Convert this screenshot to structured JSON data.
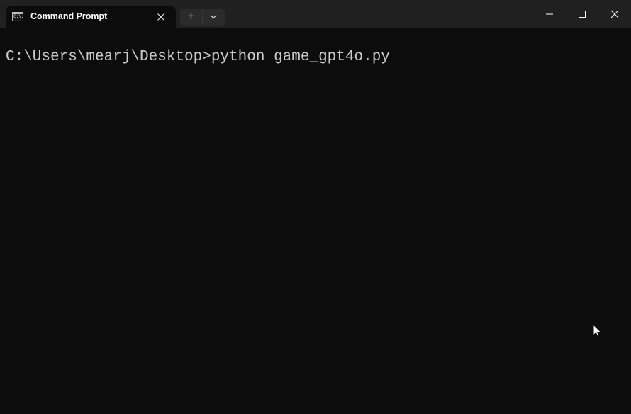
{
  "window": {
    "title": "Command Prompt",
    "tab_icon": "cmd-icon",
    "tab_icon_text": "C:\\.",
    "new_tab_icon": "+",
    "controls": {
      "minimize": "minimize-icon",
      "maximize": "maximize-icon",
      "close": "close-icon"
    }
  },
  "terminal": {
    "prompt": "C:\\Users\\mearj\\Desktop>",
    "command": "python game_gpt4o.py"
  },
  "colors": {
    "titlebar": "#202020",
    "background": "#0c0c0c",
    "text": "#cccccc"
  }
}
